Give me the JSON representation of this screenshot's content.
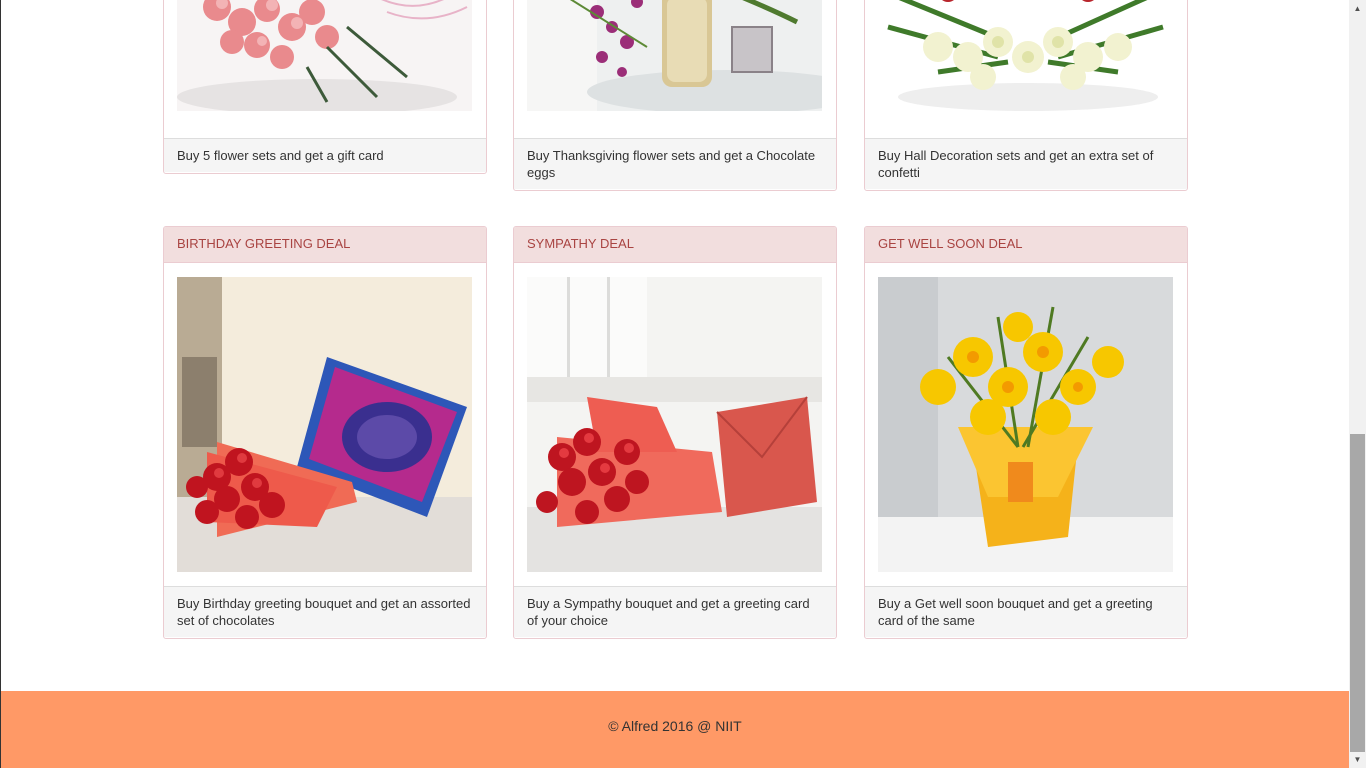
{
  "top_row": [
    {
      "footer_text": "Buy 5 flower sets and get a gift card",
      "image": "pink-roses-bouquet"
    },
    {
      "footer_text": "Buy Thanksgiving flower sets and get a Chocolate eggs",
      "image": "orchids-in-vase"
    },
    {
      "footer_text": "Buy Hall Decoration sets and get an extra set of confetti",
      "image": "carnation-arrangement"
    }
  ],
  "deals": [
    {
      "title": "BIRTHDAY GREETING DEAL",
      "footer_text": "Buy Birthday greeting bouquet and get an assorted set of chocolates",
      "image": "red-roses-with-chocolate-box"
    },
    {
      "title": "SYMPATHY DEAL",
      "footer_text": "Buy a Sympathy bouquet and get a greeting card of your choice",
      "image": "red-roses-with-envelope"
    },
    {
      "title": "GET WELL SOON DEAL",
      "footer_text": "Buy a Get well soon bouquet and get a greeting card of the same",
      "image": "yellow-lilies-bouquet"
    }
  ],
  "footer": {
    "copyright": "© Alfred 2016 @ NIIT"
  },
  "colors": {
    "panel_heading_bg": "#f2dede",
    "panel_heading_text": "#a94442",
    "panel_border": "#ebccd1",
    "footer_bg": "#ff9966"
  }
}
